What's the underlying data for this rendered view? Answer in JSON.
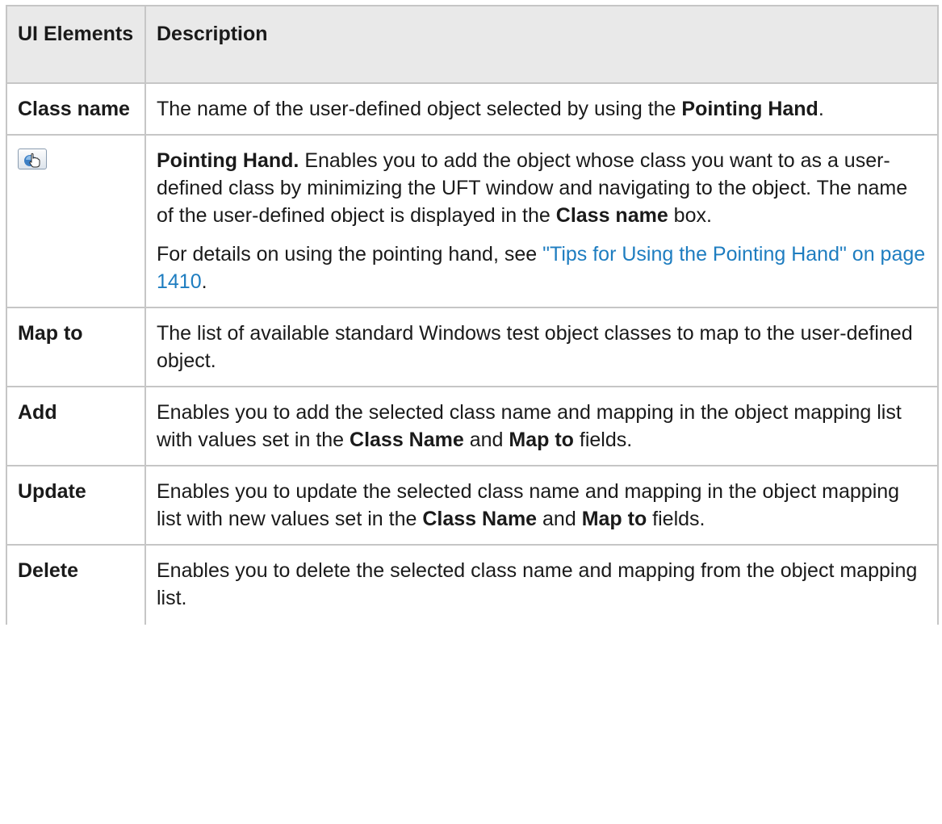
{
  "header": {
    "col1": "UI Elements",
    "col2": "Description"
  },
  "rows": {
    "class_name": {
      "term": "Class name",
      "d1": "The name of the user-defined object selected by using the ",
      "d1b": "Pointing Hand",
      "d1c": "."
    },
    "pointing_hand": {
      "icon": "pointing-hand-icon",
      "d1b": "Pointing Hand.",
      "d1": " Enables you to add the object whose class you want to as a user-defined class by minimizing the UFT window and navigating to the object. The name of the user-defined object is displayed in the ",
      "d1b2": "Class name",
      "d1c": " box.",
      "p2": "For details on using the pointing hand, see ",
      "link": "\"Tips for Using the Pointing Hand\" on page 1410",
      "p2c": "."
    },
    "map_to": {
      "term": "Map to",
      "d1": "The list of available standard Windows test object classes to map to the user-defined object."
    },
    "add": {
      "term": "Add",
      "d1": "Enables you to add the selected class name and mapping in the object mapping list with values set in the ",
      "d1b": "Class Name",
      "d1c": " and ",
      "d1b2": "Map to",
      "d1d": " fields."
    },
    "update": {
      "term": "Update",
      "d1": "Enables you to update the selected class name and mapping in the object mapping list with new values set in the ",
      "d1b": "Class Name",
      "d1c": " and ",
      "d1b2": "Map to",
      "d1d": " fields."
    },
    "delete": {
      "term": "Delete",
      "d1": "Enables you to delete the selected class name and mapping from the object mapping list."
    }
  },
  "colors": {
    "header_bg": "#e9e9e9",
    "border": "#c6c6c6",
    "link": "#1e7dc0"
  }
}
